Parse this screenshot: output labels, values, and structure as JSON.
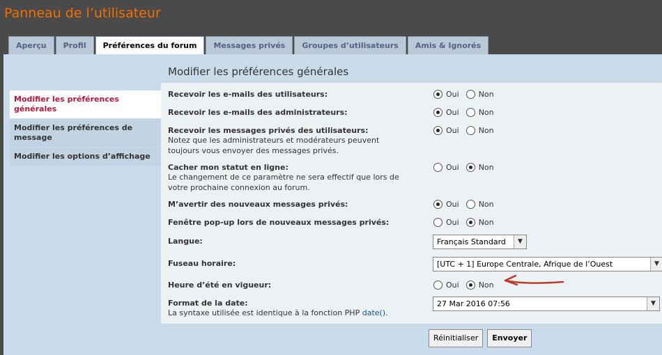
{
  "app": {
    "title": "Panneau de l’utilisateur"
  },
  "tabs": [
    {
      "label": "Aperçu"
    },
    {
      "label": "Profil"
    },
    {
      "label": "Préférences du forum",
      "active": true
    },
    {
      "label": "Messages privés"
    },
    {
      "label": "Groupes d’utilisateurs"
    },
    {
      "label": "Amis & Ignorés"
    }
  ],
  "section": {
    "title": "Modifier les préférences générales"
  },
  "menu": [
    {
      "label": "Modifier les préférences générales",
      "active": true
    },
    {
      "label": "Modifier les préférences de message"
    },
    {
      "label": "Modifier les options d’affichage"
    }
  ],
  "options": {
    "yes": "Oui",
    "no": "Non"
  },
  "settings": {
    "user_emails": {
      "label": "Recevoir les e-mails des utilisateurs:",
      "value": "Oui"
    },
    "admin_emails": {
      "label": "Recevoir les e-mails des administrateurs:",
      "value": "Oui"
    },
    "pm_users": {
      "label": "Recevoir les messages privés des utilisateurs:",
      "explain": "Notez que les administrateurs et modérateurs peuvent toujours vous envoyer des messages privés.",
      "value": "Oui"
    },
    "hide_status": {
      "label": "Cacher mon statut en ligne:",
      "explain": "Le changement de ce paramètre ne sera effectif que lors de votre prochaine connexion au forum.",
      "value": "Non"
    },
    "notify_pm": {
      "label": "M’avertir des nouveaux messages privés:",
      "value": "Oui"
    },
    "popup_pm": {
      "label": "Fenêtre pop-up lors de nouveaux messages privés:",
      "value": "Non"
    },
    "language": {
      "label": "Langue:",
      "value": "Français Standard"
    },
    "timezone": {
      "label": "Fuseau horaire:",
      "value": "[UTC + 1] Europe Centrale, Afrique de l’Ouest"
    },
    "dst": {
      "label": "Heure d’été en vigueur:",
      "value": "Non"
    },
    "date_format": {
      "label": "Format de la date:",
      "explain_prefix": "La syntaxe utilisée est identique à la fonction PHP ",
      "explain_link": "date()",
      "explain_suffix": ".",
      "value": "27 Mar 2016 07:56"
    }
  },
  "buttons": {
    "reset": "Réinitialiser",
    "submit": "Envoyer"
  },
  "colors": {
    "title": "#f26f00",
    "active_menu": "#b5173b",
    "annotation_arrow": "#c0392b",
    "panel_bg": "#cadceb"
  }
}
